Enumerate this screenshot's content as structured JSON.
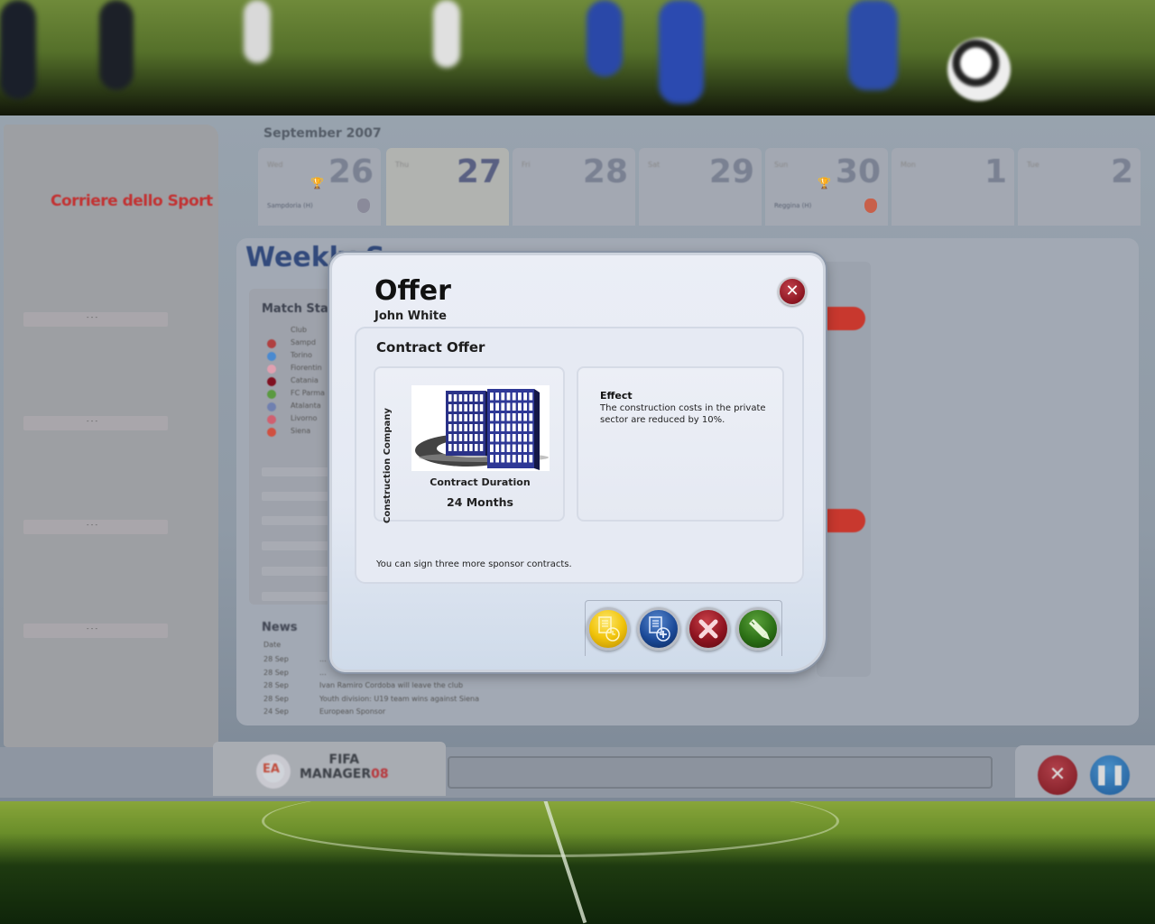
{
  "calendar": {
    "month": "September 2007",
    "days": [
      {
        "day": "26",
        "weekday": "Wed",
        "match": "Sampdoria (H)",
        "has_trophy": true
      },
      {
        "day": "27",
        "weekday": "Thu",
        "match": "",
        "has_trophy": false,
        "today": true
      },
      {
        "day": "28",
        "weekday": "Fri",
        "match": "",
        "has_trophy": false
      },
      {
        "day": "29",
        "weekday": "Sat",
        "match": "",
        "has_trophy": false
      },
      {
        "day": "30",
        "weekday": "Sun",
        "match": "Reggina (H)",
        "has_trophy": true
      },
      {
        "day": "1",
        "weekday": "Mon",
        "match": "",
        "has_trophy": false
      },
      {
        "day": "2",
        "weekday": "Tue",
        "match": "",
        "has_trophy": false
      }
    ]
  },
  "left_panel": {
    "newspaper": "Corriere dello Sport",
    "slots": [
      "- - -",
      "- - -",
      "- - -",
      "- - -"
    ]
  },
  "background_page": {
    "title": "Weekly S",
    "match_stats_title": "Match Sta",
    "club_header": "Club",
    "clubs": [
      "Sampd",
      "Torino",
      "Fiorentin",
      "Catania",
      "FC Parma",
      "Atalanta",
      "Livorno",
      "Siena"
    ],
    "news_title": "News",
    "news_header": "Date",
    "news": [
      {
        "date": "28 Sep",
        "text": "..."
      },
      {
        "date": "28 Sep",
        "text": "..."
      },
      {
        "date": "28 Sep",
        "text": "Ivan Ramiro Cordoba will leave the club"
      },
      {
        "date": "28 Sep",
        "text": "Youth division: U19 team wins against Siena"
      },
      {
        "date": "24 Sep",
        "text": "European Sponsor"
      }
    ]
  },
  "modal": {
    "title": "Offer",
    "subtitle": "John White",
    "section_title": "Contract Offer",
    "sponsor_type": "Construction Company",
    "duration_label": "Contract Duration",
    "duration_value": "24 Months",
    "effect_title": "Effect",
    "effect_text": "The construction costs in the private sector are reduced by 10%.",
    "contracts_info": "You can sign three more sponsor contracts.",
    "close_icon": "close-icon",
    "actions": [
      {
        "name": "counter-offer",
        "icon": "document-clock-icon",
        "color": "#f1c40c"
      },
      {
        "name": "add-contract",
        "icon": "document-plus-icon",
        "color": "#1c4a98"
      },
      {
        "name": "reject",
        "icon": "x-icon",
        "color": "#8e1420"
      },
      {
        "name": "sign",
        "icon": "pen-icon",
        "color": "#2c7016"
      }
    ]
  },
  "footer": {
    "publisher_logo": "EA",
    "game_logo_line1": "FIFA",
    "game_logo_line2": "MANAGER",
    "game_logo_year": "08",
    "exit_icon": "x-icon",
    "pause_icon": "pause-icon"
  }
}
